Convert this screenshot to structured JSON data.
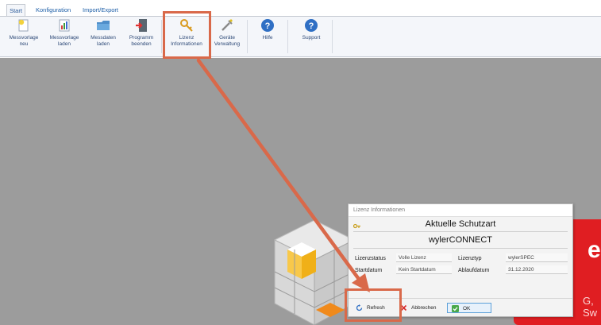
{
  "ribbon": {
    "tabs": [
      {
        "label": "Start"
      },
      {
        "label": "Konfiguration"
      },
      {
        "label": "Import/Export"
      }
    ],
    "buttons": [
      {
        "line1": "Messvorlage",
        "line2": "neu",
        "icon": "new-template-icon"
      },
      {
        "line1": "Messvorlage",
        "line2": "laden",
        "icon": "load-template-icon"
      },
      {
        "line1": "Messdaten",
        "line2": "laden",
        "icon": "folder-icon"
      },
      {
        "line1": "Programm",
        "line2": "beenden",
        "icon": "exit-icon"
      },
      {
        "line1": "Lizenz",
        "line2": "Informationen",
        "icon": "key-icon"
      },
      {
        "line1": "Geräte",
        "line2": "Verwaltung",
        "icon": "devices-icon"
      },
      {
        "line1": "Hilfe",
        "line2": "",
        "icon": "help-icon"
      },
      {
        "line1": "Support",
        "line2": "",
        "icon": "support-icon"
      }
    ]
  },
  "banner": {
    "big_text": "erS",
    "small_text": "G, Sw"
  },
  "dialog": {
    "title": "Lizenz Informationen",
    "heading": "Aktuelle Schutzart",
    "product": "wylerCONNECT",
    "fields": {
      "lizenzstatus_label": "Lizenzstatus",
      "lizenzstatus_value": "Volle Lizenz",
      "lizenztyp_label": "Lizenztyp",
      "lizenztyp_value": "wylerSPEC",
      "startdatum_label": "Startdatum",
      "startdatum_value": "Kein Startdatum",
      "ablaufdatum_label": "Ablaufdatum",
      "ablaufdatum_value": "31.12.2020"
    },
    "buttons": {
      "refresh": "Refresh",
      "cancel": "Abbrechen",
      "ok": "OK"
    }
  },
  "colors": {
    "annotation": "#d9694a",
    "banner_red": "#e01e22",
    "canvas_gray": "#9c9c9c"
  }
}
